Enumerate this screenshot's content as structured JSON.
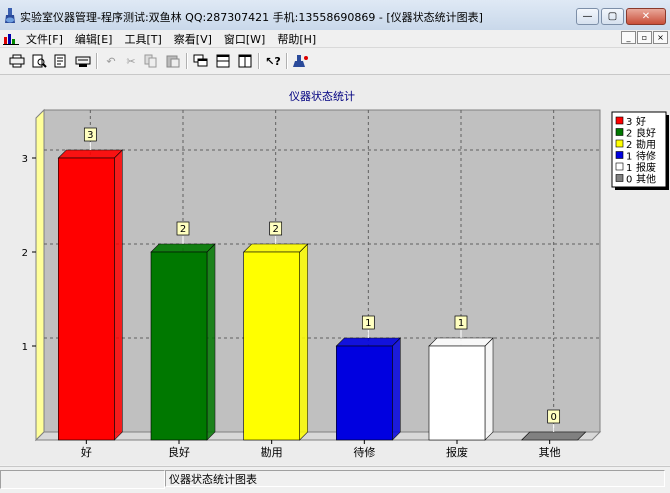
{
  "window": {
    "title": "实验室仪器管理-程序测试:双鱼林  QQ:287307421 手机:13558690869 - [仪器状态统计图表]",
    "buttons": [
      "—",
      "▢",
      "✕"
    ]
  },
  "menu": {
    "items": [
      "文件[F]",
      "编辑[E]",
      "工具[T]",
      "察看[V]",
      "窗口[W]",
      "帮助[H]"
    ],
    "mdi_buttons": [
      "_",
      "▫",
      "×"
    ]
  },
  "toolbar": {
    "icons": [
      "printer-setup-icon",
      "print-preview-icon",
      "export-icon",
      "settings-icon",
      "undo-icon",
      "cut-icon",
      "copy-icon",
      "paste-icon",
      "cascade-icon",
      "tile-horizontal-icon",
      "tile-vertical-icon",
      "context-help-icon",
      "about-icon"
    ]
  },
  "chart_data": {
    "type": "bar",
    "title": "仪器状态统计",
    "categories": [
      "好",
      "良好",
      "勘用",
      "待修",
      "报废",
      "其他"
    ],
    "values": [
      3,
      2,
      2,
      1,
      1,
      0
    ],
    "colors": [
      "#ff0000",
      "#007800",
      "#ffff00",
      "#0000e0",
      "#ffffff",
      "#808080"
    ],
    "ylim": [
      0,
      3
    ],
    "yticks": [
      1,
      2,
      3
    ],
    "grid": true,
    "style": "3d",
    "legend": {
      "position": "right",
      "entries": [
        {
          "value": "3",
          "label": "好"
        },
        {
          "value": "2",
          "label": "良好"
        },
        {
          "value": "2",
          "label": "勘用"
        },
        {
          "value": "1",
          "label": "待修"
        },
        {
          "value": "1",
          "label": "报废"
        },
        {
          "value": "0",
          "label": "其他"
        }
      ]
    }
  },
  "status": {
    "text": "仪器状态统计图表"
  }
}
